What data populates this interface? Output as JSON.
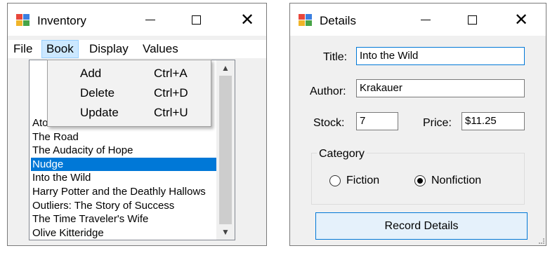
{
  "inventory": {
    "title": "Inventory",
    "menu": [
      "File",
      "Book",
      "Display",
      "Values"
    ],
    "book_menu": [
      {
        "label": "Add",
        "shortcut": "Ctrl+A"
      },
      {
        "label": "Delete",
        "shortcut": "Ctrl+D"
      },
      {
        "label": "Update",
        "shortcut": "Ctrl+U"
      }
    ],
    "books": [
      "Atonement",
      "The Road",
      "The Audacity of Hope",
      "Nudge",
      "Into the Wild",
      "Harry Potter and the Deathly Hallows",
      "Outliers: The Story of Success",
      "The Time Traveler's Wife",
      "Olive Kitteridge"
    ],
    "selected_book": "Nudge"
  },
  "details": {
    "title": "Details",
    "labels": {
      "title": "Title:",
      "author": "Author:",
      "stock": "Stock:",
      "price": "Price:"
    },
    "values": {
      "title": "Into the Wild",
      "author": "Krakauer",
      "stock": "7",
      "price": "$11.25"
    },
    "category": {
      "title": "Category",
      "options": [
        "Fiction",
        "Nonfiction"
      ],
      "selected": "Nonfiction"
    },
    "button": "Record Details"
  },
  "colors": {
    "selection": "#0078d7",
    "menu_highlight": "#cce8ff",
    "button_bg": "#e5f1fb",
    "window_bg": "#f0f0f0"
  }
}
